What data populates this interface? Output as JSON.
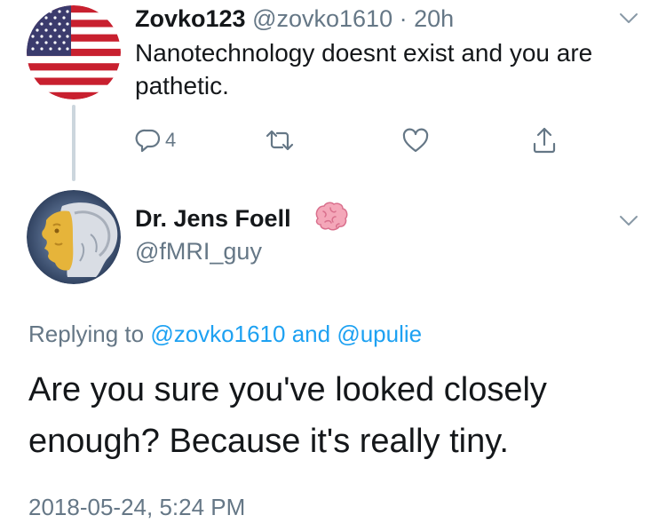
{
  "tweet1": {
    "display_name": "Zovko123",
    "handle": "@zovko1610",
    "separator": "·",
    "time": "20h",
    "text": "Nanotechnology doesnt exist and you are pathetic.",
    "reply_count": "4",
    "avatar": "us-flag-avatar",
    "more_icon": "chevron-down-icon"
  },
  "tweet2": {
    "display_name": "Dr. Jens Foell",
    "name_emoji": "brain-emoji",
    "handle": "@fMRI_guy",
    "replying_prefix": "Replying to",
    "replying_user1": "@zovko1610",
    "replying_and": "and",
    "replying_user2": "@upulie",
    "text": "Are you sure you've looked closely enough? Because it's really tiny.",
    "timestamp": "2018-05-24, 5:24 PM",
    "avatar": "skull-scan-avatar",
    "more_icon": "chevron-down-icon"
  },
  "colors": {
    "text": "#14171a",
    "secondary": "#657786",
    "link": "#1da1f2",
    "thread_line": "#ccd6dd"
  }
}
